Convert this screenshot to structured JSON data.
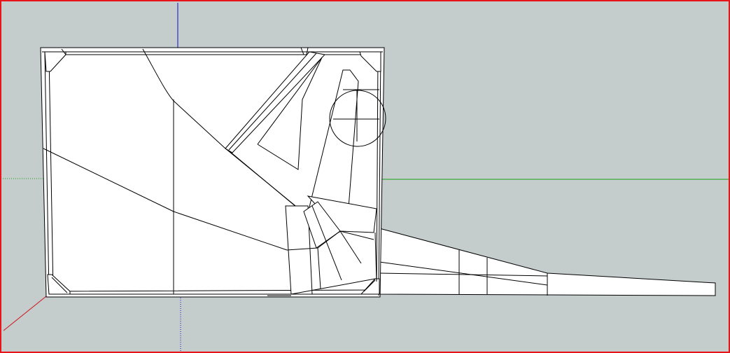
{
  "viewport": {
    "background_color": "#c4cccc",
    "frame_color": "#e8141c",
    "model_fill_color": "#ffffff",
    "edge_color": "#000000"
  },
  "axes": {
    "red_axis_color": "#d0101a",
    "green_axis_color": "#18a018",
    "blue_axis_color": "#1010c8"
  }
}
